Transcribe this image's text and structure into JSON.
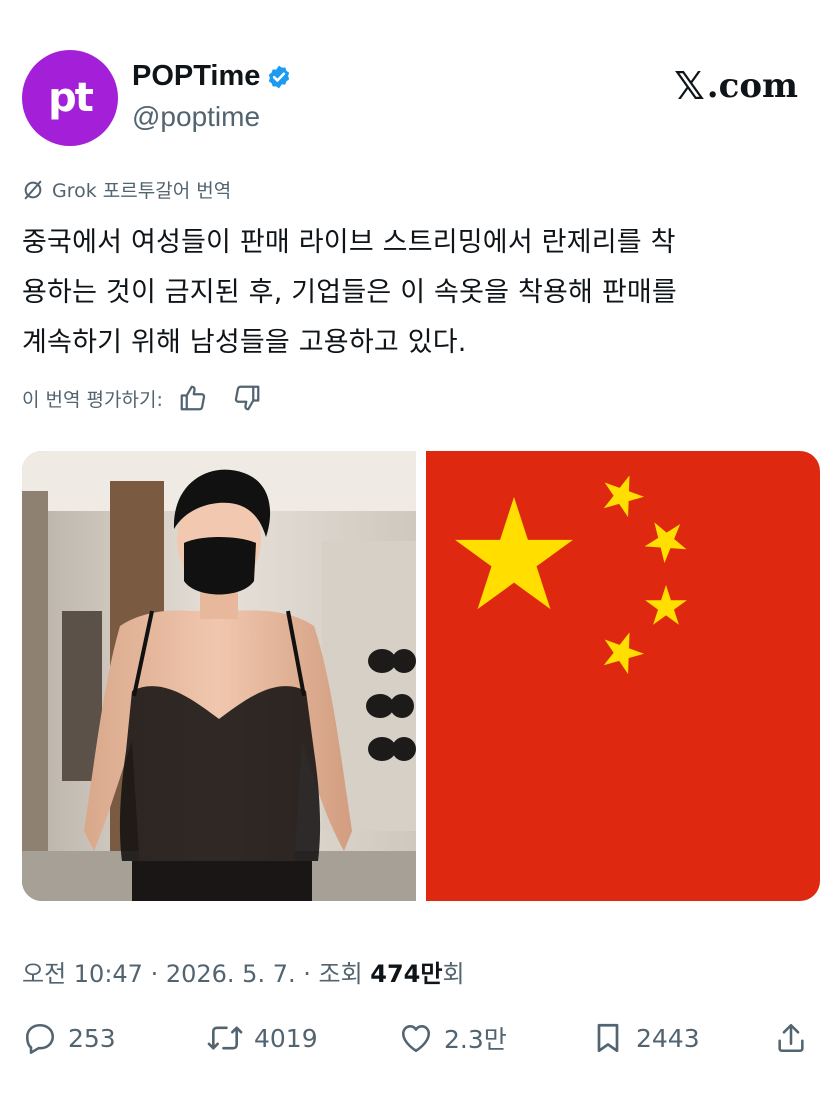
{
  "author": {
    "avatar_text": "pt",
    "display_name": "POPTime",
    "handle": "@poptime",
    "avatar_color": "#a41fd8",
    "verified_color": "#1d9bf0"
  },
  "site_logo": {
    "x_glyph": "𝕏",
    "suffix": ".com"
  },
  "translation_label": "Grok 포르투갈어 번역",
  "tweet_lines": [
    "중국에서 여성들이 판매 라이브 스트리밍에서 란제리를 착",
    "용하는 것이 금지된 후, 기업들은 이 속옷을 착용해 판매를",
    "계속하기 위해 남성들을 고용하고 있다."
  ],
  "rate_label": "이 번역 평가하기:",
  "media": {
    "left_image": "man-in-black-lingerie-with-face-mask-photo",
    "right_image": "china-flag",
    "flag_red": "#de2910",
    "flag_yellow": "#ffde00"
  },
  "meta": {
    "time_date": "오전 10:47 · 2026. 5. 7. · 조회 ",
    "views": "474만",
    "views_suffix": "회"
  },
  "actions": {
    "replies": "253",
    "reposts": "4019",
    "likes": "2.3만",
    "bookmarks": "2443"
  }
}
